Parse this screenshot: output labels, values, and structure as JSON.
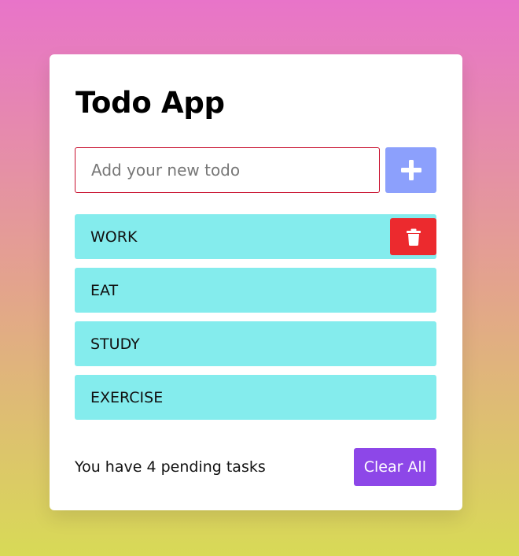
{
  "app": {
    "title": "Todo App"
  },
  "input": {
    "placeholder": "Add your new todo",
    "value": ""
  },
  "add_button": {
    "icon": "plus-icon"
  },
  "todos": [
    {
      "text": "WORK",
      "hovered": true
    },
    {
      "text": "EAT"
    },
    {
      "text": "STUDY"
    },
    {
      "text": "EXERCISE"
    }
  ],
  "delete_button": {
    "icon": "trash-icon"
  },
  "footer": {
    "pending_prefix": "You have ",
    "pending_count": "4",
    "pending_suffix": " pending tasks",
    "clear_label": "Clear All"
  },
  "colors": {
    "background_top": "#e874c9",
    "background_bottom": "#d8da56",
    "input_border": "#c8102e",
    "add_button": "#8ca0fc",
    "todo_item": "#84eced",
    "delete_button": "#ec2a2e",
    "clear_button": "#8d47e8"
  }
}
